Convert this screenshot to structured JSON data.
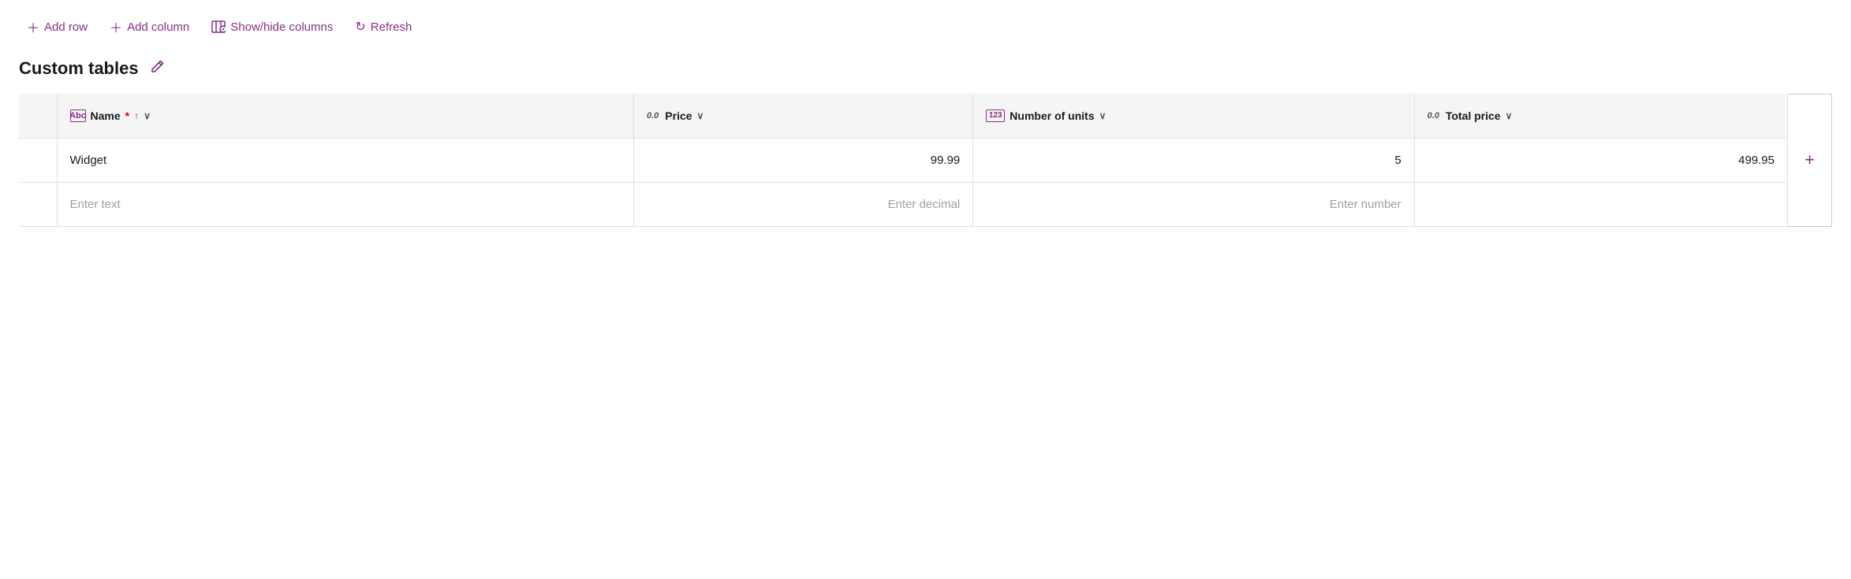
{
  "toolbar": {
    "add_row_label": "Add row",
    "add_column_label": "Add column",
    "show_hide_label": "Show/hide columns",
    "refresh_label": "Refresh"
  },
  "page": {
    "title": "Custom tables",
    "edit_tooltip": "Edit"
  },
  "table": {
    "columns": [
      {
        "id": "name",
        "type_icon": "Abc",
        "type_display": "",
        "label": "Name",
        "required": true,
        "sortable": true,
        "has_chevron": true,
        "align": "left"
      },
      {
        "id": "price",
        "type_icon": "0.0",
        "type_display": "decimal",
        "label": "Price",
        "required": false,
        "sortable": false,
        "has_chevron": true,
        "align": "right"
      },
      {
        "id": "number_of_units",
        "type_icon": "123",
        "type_display": "number",
        "label": "Number of units",
        "required": false,
        "sortable": false,
        "has_chevron": true,
        "align": "right"
      },
      {
        "id": "total_price",
        "type_icon": "0.0",
        "type_display": "decimal",
        "label": "Total price",
        "required": false,
        "sortable": false,
        "has_chevron": true,
        "align": "right"
      }
    ],
    "rows": [
      {
        "name": "Widget",
        "price": "99.99",
        "number_of_units": "5",
        "total_price": "499.95"
      }
    ],
    "new_row_placeholders": {
      "name": "Enter text",
      "price": "Enter decimal",
      "number_of_units": "Enter number",
      "total_price": ""
    },
    "add_column_label": "+"
  },
  "colors": {
    "accent": "#8a2e8a",
    "header_bg": "#f5f5f5",
    "border": "#e0e0e0",
    "placeholder": "#a0a0a0"
  }
}
